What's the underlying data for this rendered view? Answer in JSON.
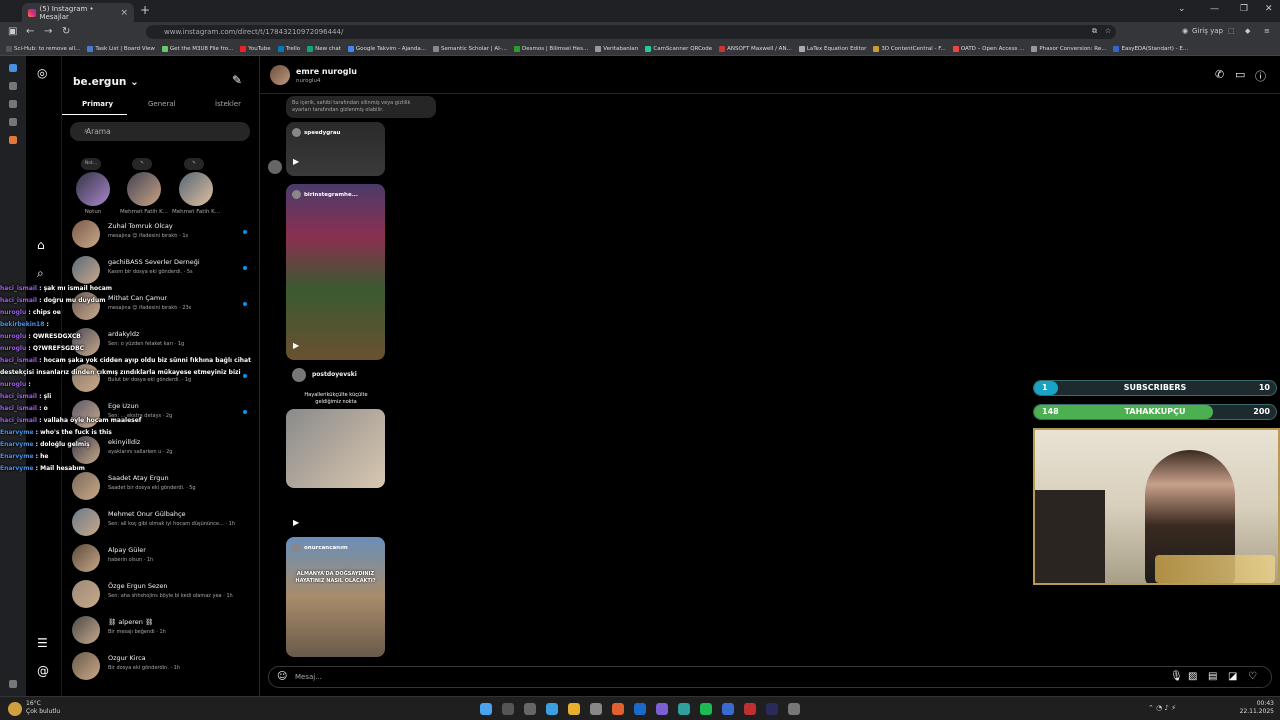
{
  "browser": {
    "tab_title": "(5) Instagram • Mesajlar",
    "url": "www.instagram.com/direct/t/17843210972096444/",
    "profile_label": "Giriş yap",
    "bookmarks": [
      "Sci-Hub: to remove all...",
      "Task List | Board View",
      "Get the M3U8 File fro...",
      "YouTube",
      "Trello",
      "New chat",
      "Google Takvim - Ajanda...",
      "Semantic Scholar | AI-...",
      "Desmos | Bilimsel Hes...",
      "Veritabanları",
      "CamScanner QRCode",
      "ANSOFT Maxwell / AN...",
      "LaTex Equation Editor",
      "3D ContentCentral - F...",
      "OATD – Open Access ...",
      "Phasor Conversion: Re...",
      "EasyEDA(Standart) - E..."
    ]
  },
  "inbox": {
    "username": "be.ergun",
    "tabs": [
      "Primary",
      "General",
      "İstekler"
    ],
    "search_placeholder": "Arama",
    "notes": [
      {
        "bubble": "Not...",
        "label": "Notun"
      },
      {
        "bubble": "✎",
        "label": "Mehmet Fatih K..."
      },
      {
        "bubble": "✎",
        "label": "Mehmet Fatih K..."
      }
    ],
    "conversations": [
      {
        "name": "Zuhal Tomruk Olcay",
        "preview": "mesajına 😊 ifadesini bıraktı · 1s",
        "unread": true
      },
      {
        "name": "gachiBASS Severler Derneği",
        "preview": "Kasım bir dosya eki gönderdi. · 5s",
        "unread": true
      },
      {
        "name": "Mithat Can Çamur",
        "preview": "mesajına 😊 ifadesini bıraktı · 23s",
        "unread": true
      },
      {
        "name": "ardakyldz",
        "preview": "Sen: o yüzden felaket karı · 1g",
        "unread": false
      },
      {
        "name": "",
        "preview": "Bulut bir dosya eki gönderdi. · 1g",
        "unread": true
      },
      {
        "name": "Ege Uzun",
        "preview": "Sen: ... ekstra detays · 2g",
        "unread": true
      },
      {
        "name": "ekinyilldiz",
        "preview": "ayaklarını sallarken u · 2g",
        "unread": false
      },
      {
        "name": "Saadet Atay Ergun",
        "preview": "Saadet bir dosya eki gönderdi. · 5g",
        "unread": false
      },
      {
        "name": "Mehmet Onur Gülbahçe",
        "preview": "Sen: all koç gibi olmak iyi hocam düşününce... · 1h",
        "unread": false
      },
      {
        "name": "Alpay Güler",
        "preview": "haberin olsun · 1h",
        "unread": false
      },
      {
        "name": "Özge Ergun Sezen",
        "preview": "Sen: aha shhshojins böyle bi kedi olamaz yea · 1h",
        "unread": false
      },
      {
        "name": "⛓ alperen ⛓",
        "preview": "Bir mesajı beğendi · 1h",
        "unread": false
      },
      {
        "name": "Ozgur Kirca",
        "preview": "Bir dosya eki gönderdin. · 1h",
        "unread": false
      }
    ]
  },
  "chat": {
    "name": "emre nuroglu",
    "handle": "nuroglu4",
    "hidden_notice": "Bu içerik, sahibi tarafından silinmiş veya gizlilik ayarları tarafından gizlenmiş olabilir.",
    "reels": [
      {
        "author": "speedygrau"
      },
      {
        "author": "birinstegramhe..."
      },
      {
        "author": "onurcancanım",
        "overlay": "ALMANYA'DA DOĞSAYDINIZ HAYATINIZ NASIL OLACAKTI?"
      }
    ],
    "post_author": "postdoyevski",
    "post_caption": "Hayallerikükçülte küçülte geldiğimiz nokta",
    "message_placeholder": "Mesaj..."
  },
  "twitch_chat": [
    {
      "user": "haci_ismail",
      "color": "#9b5de5",
      "text": "şak mı ismail hocam"
    },
    {
      "user": "haci_ismail",
      "color": "#9b5de5",
      "text": "doğru mu duydum"
    },
    {
      "user": "nuroglu",
      "color": "#9b5de5",
      "text": "chips oe"
    },
    {
      "user": "bekirbekin18",
      "color": "#4a90e2",
      "text": ""
    },
    {
      "user": "nuroglu",
      "color": "#9b5de5",
      "text": "QWRESDGXCB"
    },
    {
      "user": "nuroglu",
      "color": "#9b5de5",
      "text": "Q?WREFSGDBC"
    },
    {
      "user": "haci_ismail",
      "color": "#9b5de5",
      "text": "hocam şaka yok cidden ayıp oldu biz sünni fıkhına bağlı cihat"
    },
    {
      "user": "",
      "color": "#fff",
      "text": "destekçisi insanlarız dinden çıkmış zındıklarla mükayese etmeyiniz bizi"
    },
    {
      "user": "nuroglu",
      "color": "#9b5de5",
      "text": ""
    },
    {
      "user": "haci_ismail",
      "color": "#9b5de5",
      "text": "şli"
    },
    {
      "user": "haci_ismail",
      "color": "#9b5de5",
      "text": "o"
    },
    {
      "user": "haci_ismail",
      "color": "#9b5de5",
      "text": "vallaha öyle hocam maalesef"
    },
    {
      "user": "Enarvyme",
      "color": "#4a90e2",
      "text": "who's the fuck is this"
    },
    {
      "user": "Enarvyme",
      "color": "#4a90e2",
      "text": "doloğlu gelmiş"
    },
    {
      "user": "Enarvyme",
      "color": "#4a90e2",
      "text": "he"
    },
    {
      "user": "Enarvyme",
      "color": "#4a90e2",
      "text": "Mail hesabım"
    }
  ],
  "stream": {
    "subs": {
      "current": "1",
      "label": "SUBSCRIBERS",
      "goal": "10",
      "progress": 0.1,
      "color": "#1aa3c4"
    },
    "tahakkupcu": {
      "current": "148",
      "label": "TAHAKKUPÇU",
      "goal": "200",
      "progress": 0.74,
      "color": "#4caf50"
    }
  },
  "taskbar": {
    "weather_temp": "16°C",
    "weather_desc": "Çok bulutlu",
    "time": "00:43",
    "date": "22.11.2025"
  }
}
